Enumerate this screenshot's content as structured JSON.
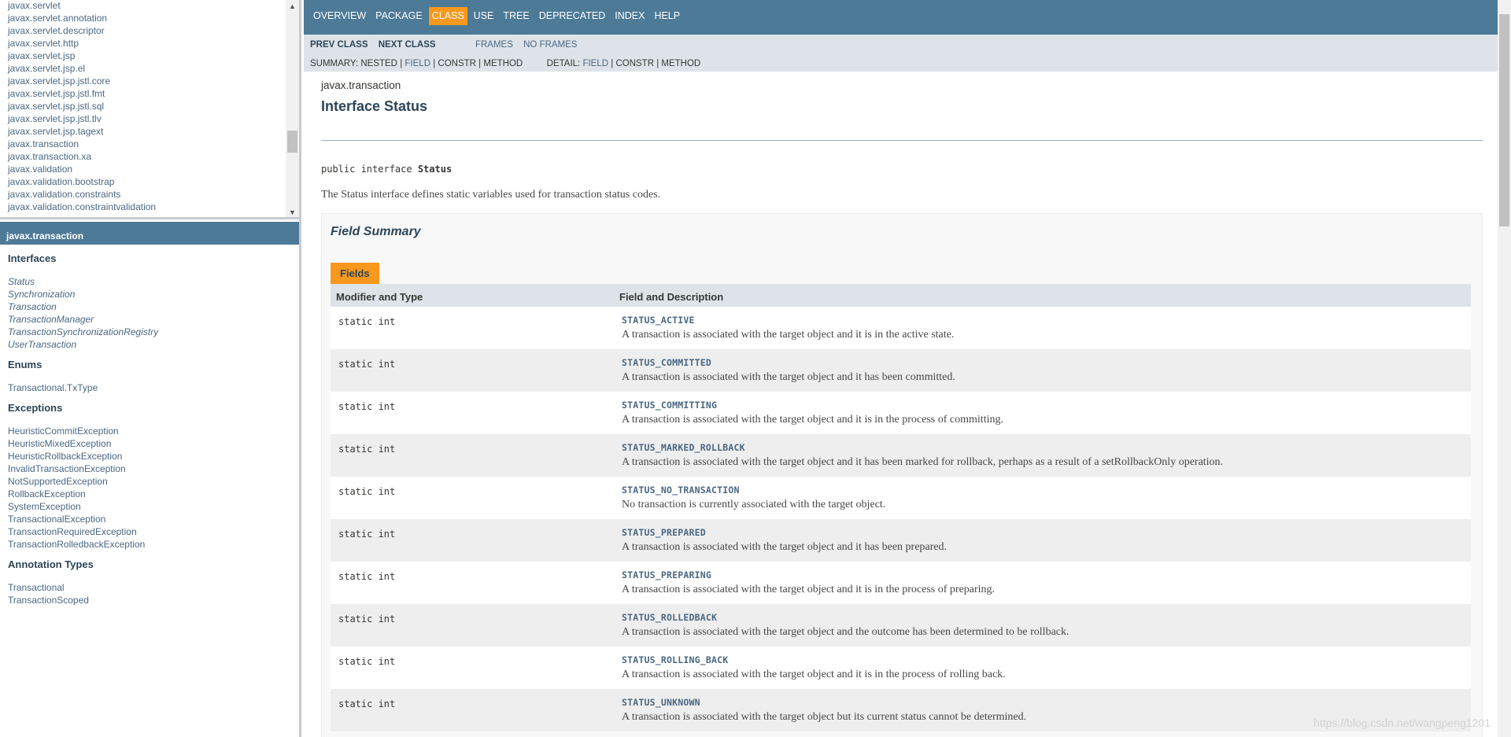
{
  "package_list": {
    "items": [
      "javax.servlet",
      "javax.servlet.annotation",
      "javax.servlet.descriptor",
      "javax.servlet.http",
      "javax.servlet.jsp",
      "javax.servlet.jsp.el",
      "javax.servlet.jsp.jstl.core",
      "javax.servlet.jsp.jstl.fmt",
      "javax.servlet.jsp.jstl.sql",
      "javax.servlet.jsp.jstl.tlv",
      "javax.servlet.jsp.tagext",
      "javax.transaction",
      "javax.transaction.xa",
      "javax.validation",
      "javax.validation.bootstrap",
      "javax.validation.constraints",
      "javax.validation.constraintvalidation"
    ]
  },
  "class_frame": {
    "header": "javax.transaction",
    "interfaces_title": "Interfaces",
    "interfaces": [
      "Status",
      "Synchronization",
      "Transaction",
      "TransactionManager",
      "TransactionSynchronizationRegistry",
      "UserTransaction"
    ],
    "enums_title": "Enums",
    "enums": [
      "Transactional.TxType"
    ],
    "exceptions_title": "Exceptions",
    "exceptions": [
      "HeuristicCommitException",
      "HeuristicMixedException",
      "HeuristicRollbackException",
      "InvalidTransactionException",
      "NotSupportedException",
      "RollbackException",
      "SystemException",
      "TransactionalException",
      "TransactionRequiredException",
      "TransactionRolledbackException"
    ],
    "annotations_title": "Annotation Types",
    "annotations": [
      "Transactional",
      "TransactionScoped"
    ]
  },
  "topnav": {
    "items": [
      "OVERVIEW",
      "PACKAGE",
      "CLASS",
      "USE",
      "TREE",
      "DEPRECATED",
      "INDEX",
      "HELP"
    ],
    "active": "CLASS"
  },
  "subnav": {
    "prev_class": "PREV CLASS",
    "next_class": "NEXT CLASS",
    "frames": "FRAMES",
    "no_frames": "NO FRAMES",
    "summary_label": "SUMMARY:",
    "nested": "NESTED",
    "field": "FIELD",
    "constr": "CONSTR",
    "method": "METHOD",
    "detail_label": "DETAIL:",
    "sep": "|"
  },
  "header": {
    "package": "javax.transaction",
    "title": "Interface Status",
    "signature_prefix": "public interface ",
    "signature_name": "Status",
    "description": "The Status interface defines static variables used for transaction status codes."
  },
  "field_summary": {
    "title": "Field Summary",
    "tab": "Fields",
    "col1": "Modifier and Type",
    "col2": "Field and Description",
    "rows": [
      {
        "type": "static int",
        "name": "STATUS_ACTIVE",
        "desc": "A transaction is associated with the target object and it is in the active state."
      },
      {
        "type": "static int",
        "name": "STATUS_COMMITTED",
        "desc": "A transaction is associated with the target object and it has been committed."
      },
      {
        "type": "static int",
        "name": "STATUS_COMMITTING",
        "desc": "A transaction is associated with the target object and it is in the process of committing."
      },
      {
        "type": "static int",
        "name": "STATUS_MARKED_ROLLBACK",
        "desc": "A transaction is associated with the target object and it has been marked for rollback, perhaps as a result of a setRollbackOnly operation."
      },
      {
        "type": "static int",
        "name": "STATUS_NO_TRANSACTION",
        "desc": "No transaction is currently associated with the target object."
      },
      {
        "type": "static int",
        "name": "STATUS_PREPARED",
        "desc": "A transaction is associated with the target object and it has been prepared."
      },
      {
        "type": "static int",
        "name": "STATUS_PREPARING",
        "desc": "A transaction is associated with the target object and it is in the process of preparing."
      },
      {
        "type": "static int",
        "name": "STATUS_ROLLEDBACK",
        "desc": "A transaction is associated with the target object and the outcome has been determined to be rollback."
      },
      {
        "type": "static int",
        "name": "STATUS_ROLLING_BACK",
        "desc": "A transaction is associated with the target object and it is in the process of rolling back."
      },
      {
        "type": "static int",
        "name": "STATUS_UNKNOWN",
        "desc": "A transaction is associated with the target object but its current status cannot be determined."
      }
    ]
  },
  "watermark": "https://blog.csdn.net/wangpeng1201",
  "colors": {
    "nav_bg": "#4d7a97",
    "subnav_bg": "#dee3e9",
    "accent": "#f8981d",
    "link": "#4a6782",
    "title": "#2c4557",
    "row_alt": "#eeeeef"
  },
  "icons": {
    "scroll_up": "triangle-up-icon",
    "scroll_down": "triangle-down-icon"
  }
}
